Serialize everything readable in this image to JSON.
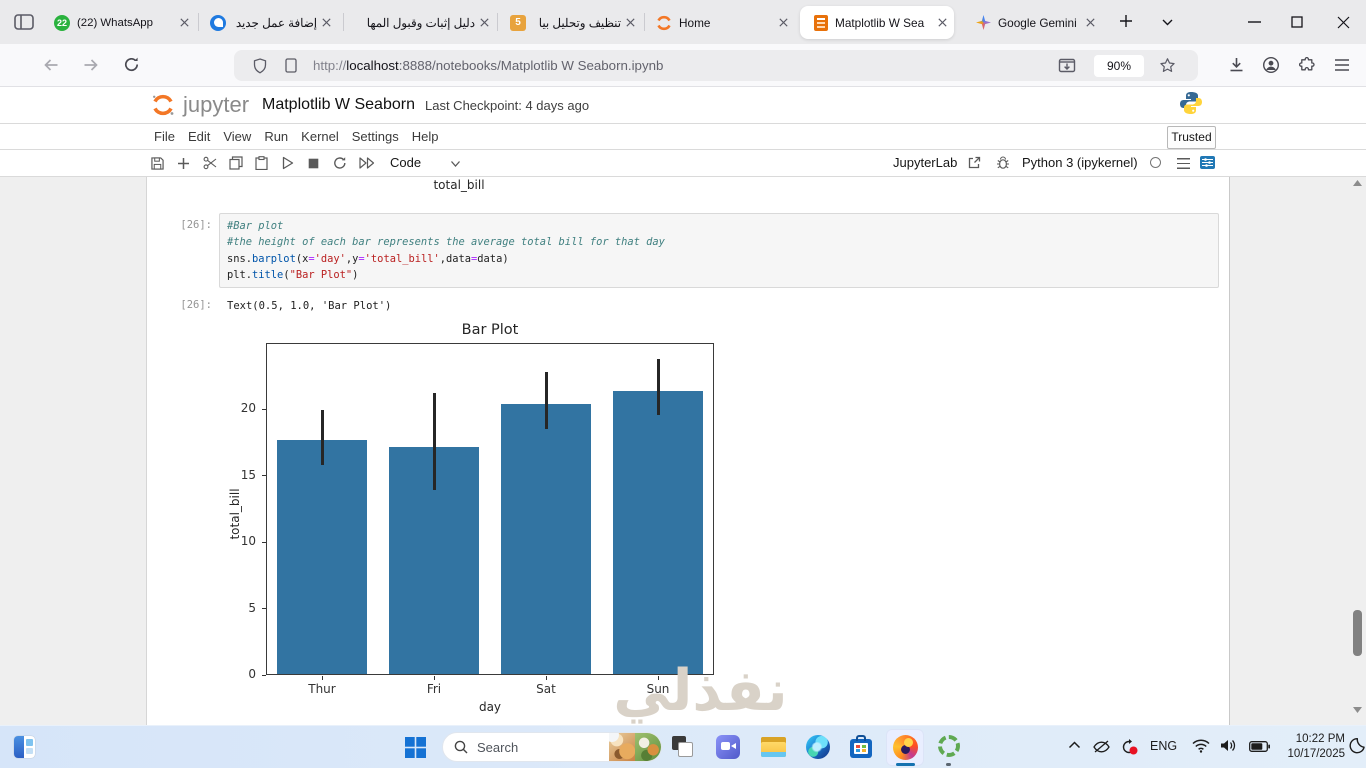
{
  "browser": {
    "tabs": [
      {
        "title": "(22) WhatsApp",
        "badge": "22"
      },
      {
        "title": "إضافة عمل جديد |"
      },
      {
        "title": "دليل إثبات وقبول المها"
      },
      {
        "title": "تنظيف وتحليل بيا",
        "badge": "5"
      },
      {
        "title": "Home"
      },
      {
        "title": "Matplotlib W Sea",
        "active": true
      },
      {
        "title": "Google Gemini"
      }
    ],
    "url": {
      "protocol": "http://",
      "host": "localhost",
      "path": ":8888/notebooks/Matplotlib W Seaborn.ipynb"
    },
    "zoom_level": "90%"
  },
  "jupyter": {
    "logo_text": "jupyter",
    "title": "Matplotlib W Seaborn",
    "checkpoint": "Last Checkpoint: 4 days ago",
    "menu": [
      "File",
      "Edit",
      "View",
      "Run",
      "Kernel",
      "Settings",
      "Help"
    ],
    "trusted": "Trusted",
    "toolbar": {
      "cell_type": "Code",
      "jupyterlab": "JupyterLab",
      "kernel": "Python 3 (ipykernel)"
    },
    "prev_output_label": "total_bill",
    "cell": {
      "prompt_in": "[26]:",
      "prompt_out": "[26]:",
      "output": "Text(0.5, 1.0, 'Bar Plot')",
      "code_lines": [
        [
          {
            "t": "#Bar plot",
            "c": "com"
          }
        ],
        [
          {
            "t": "#the height of each bar represents the average total bill for that day",
            "c": "com"
          }
        ],
        [
          {
            "t": "sns.",
            "c": "def"
          },
          {
            "t": "barplot",
            "c": "prop"
          },
          {
            "t": "(x",
            "c": "def"
          },
          {
            "t": "=",
            "c": "op"
          },
          {
            "t": "'day'",
            "c": "str"
          },
          {
            "t": ",y",
            "c": "def"
          },
          {
            "t": "=",
            "c": "op"
          },
          {
            "t": "'total_bill'",
            "c": "str"
          },
          {
            "t": ",data",
            "c": "def"
          },
          {
            "t": "=",
            "c": "op"
          },
          {
            "t": "data)",
            "c": "def"
          }
        ],
        [
          {
            "t": "plt.",
            "c": "def"
          },
          {
            "t": "title",
            "c": "prop"
          },
          {
            "t": "(",
            "c": "def"
          },
          {
            "t": "\"Bar Plot\"",
            "c": "str"
          },
          {
            "t": ")",
            "c": "def"
          }
        ]
      ]
    }
  },
  "chart_data": {
    "type": "bar",
    "title": "Bar Plot",
    "xlabel": "day",
    "ylabel": "total_bill",
    "categories": [
      "Thur",
      "Fri",
      "Sat",
      "Sun"
    ],
    "values": [
      17.68,
      17.15,
      20.44,
      21.41
    ],
    "error_low": [
      15.85,
      13.95,
      18.55,
      19.55
    ],
    "error_high": [
      19.95,
      21.25,
      22.85,
      23.8
    ],
    "yticks": [
      0,
      5,
      10,
      15,
      20
    ],
    "ylim": [
      0,
      25
    ],
    "bar_color": "#3274a2",
    "error_color": "#262626",
    "grid": false,
    "legend": null
  },
  "watermark": "نفذلي",
  "taskbar": {
    "search_placeholder": "Search",
    "language": "ENG",
    "time": "10:22 PM",
    "date": "10/17/2025"
  }
}
